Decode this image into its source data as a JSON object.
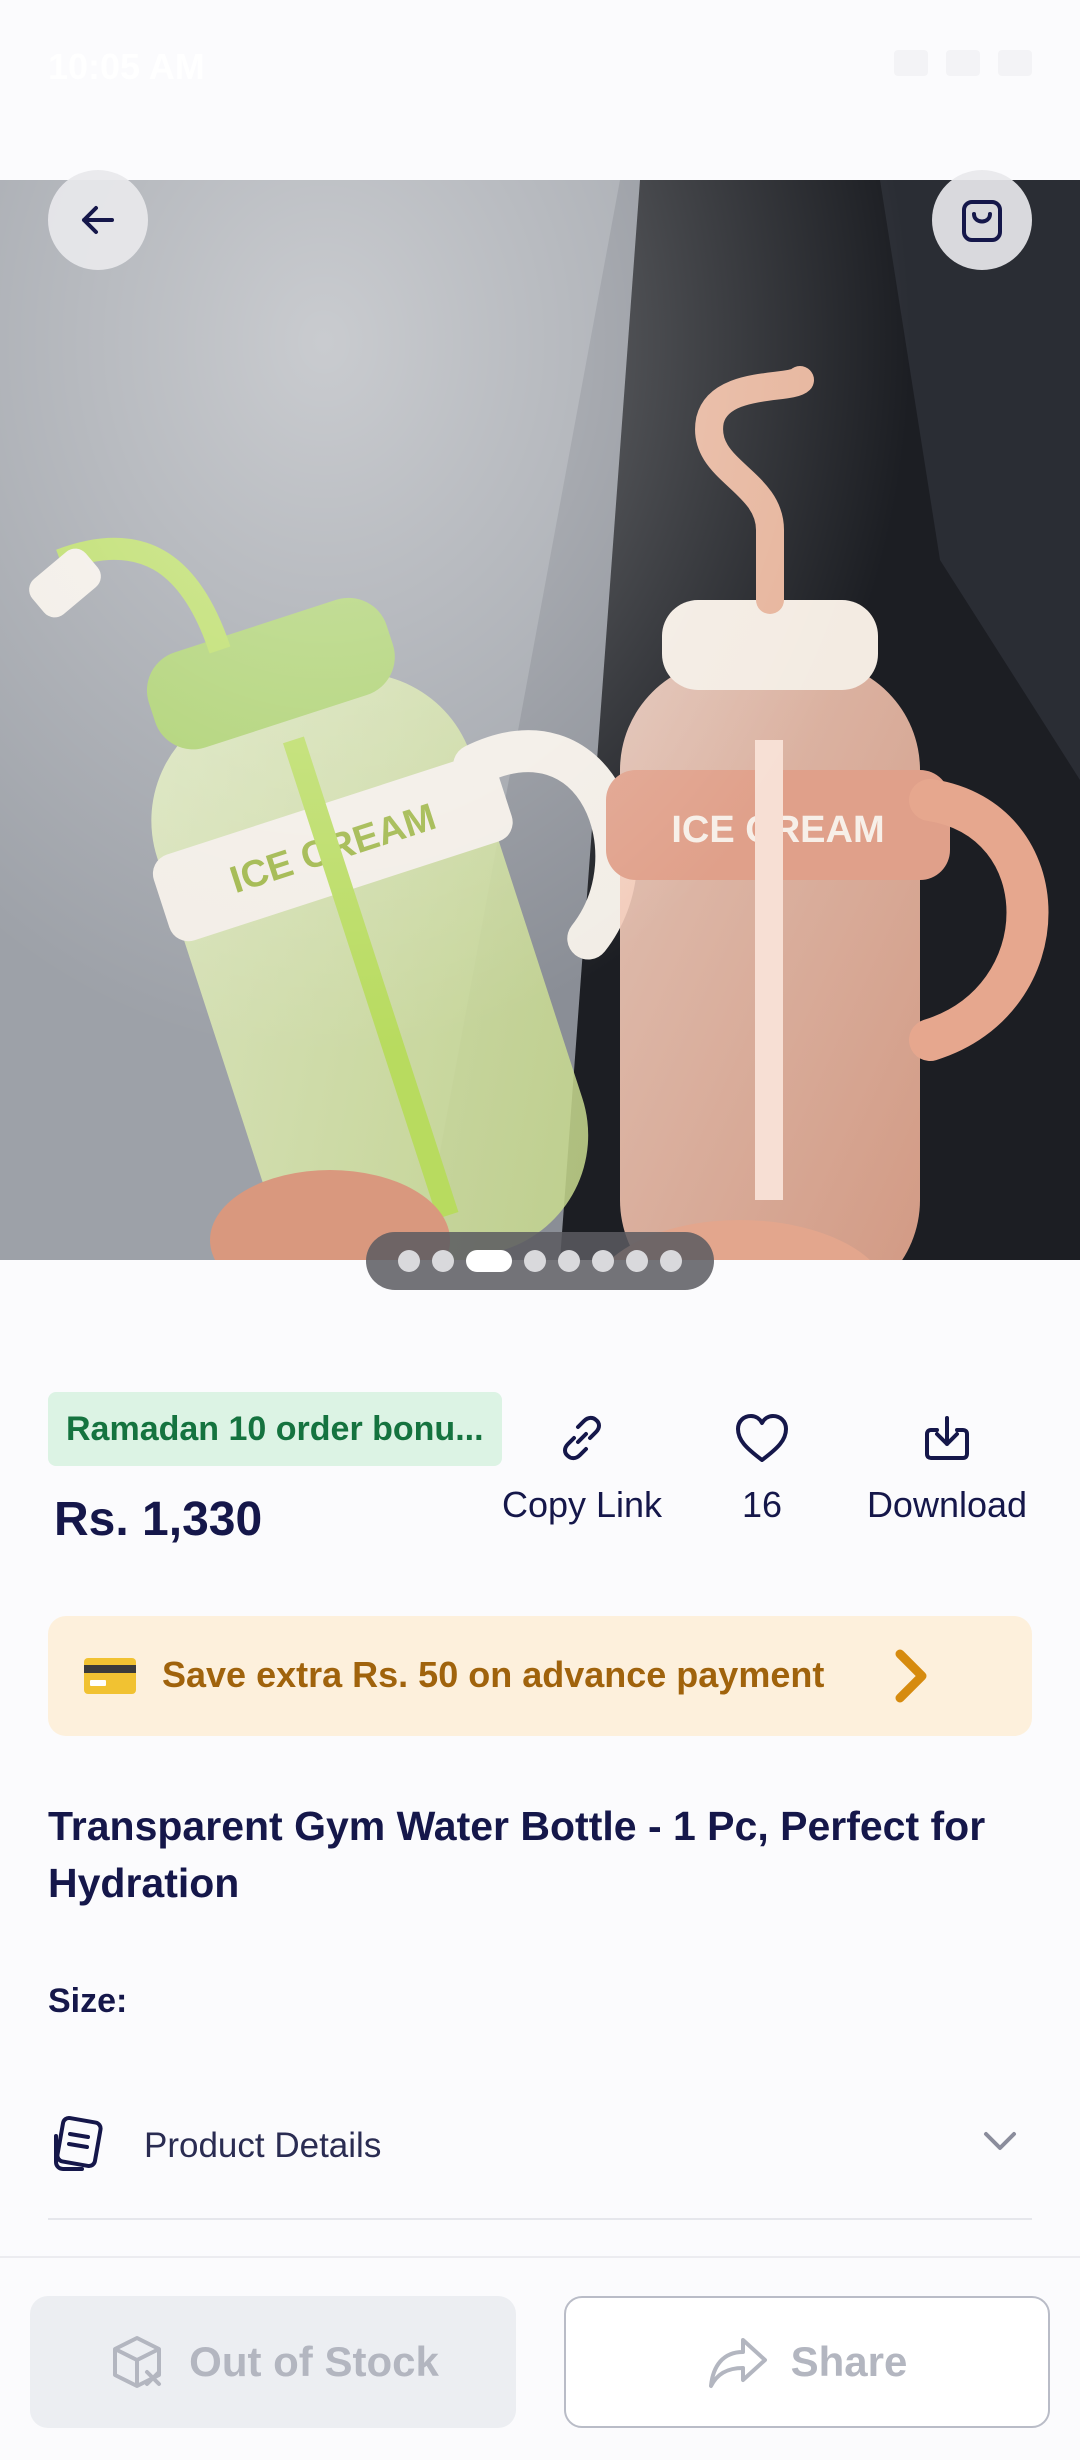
{
  "status": {
    "time": "10:05 AM"
  },
  "product": {
    "promo_badge": "Ramadan 10 order bonu...",
    "price": "Rs. 1,330",
    "title": "Transparent Gym Water Bottle - 1 Pc, Perfect for Hydration",
    "size_label": "Size:",
    "image_count": 8,
    "active_image_index": 2
  },
  "actions": {
    "copy_link": "Copy Link",
    "likes": "16",
    "download": "Download"
  },
  "payment_banner": {
    "text": "Save extra Rs. 50 on advance payment"
  },
  "details": {
    "label": "Product Details"
  },
  "bottom": {
    "out_of_stock": "Out of Stock",
    "share": "Share"
  },
  "colors": {
    "accent": "#15174a",
    "promo_bg": "#dcf3e4",
    "promo_text": "#15733f",
    "banner_bg": "#fdf0dc",
    "banner_text": "#a0630c"
  },
  "icons": [
    "arrow-left-icon",
    "shopping-bag-icon",
    "link-icon",
    "heart-icon",
    "download-icon",
    "credit-card-icon",
    "chevron-right-icon",
    "document-icon",
    "chevron-down-icon",
    "box-x-icon",
    "share-icon"
  ]
}
